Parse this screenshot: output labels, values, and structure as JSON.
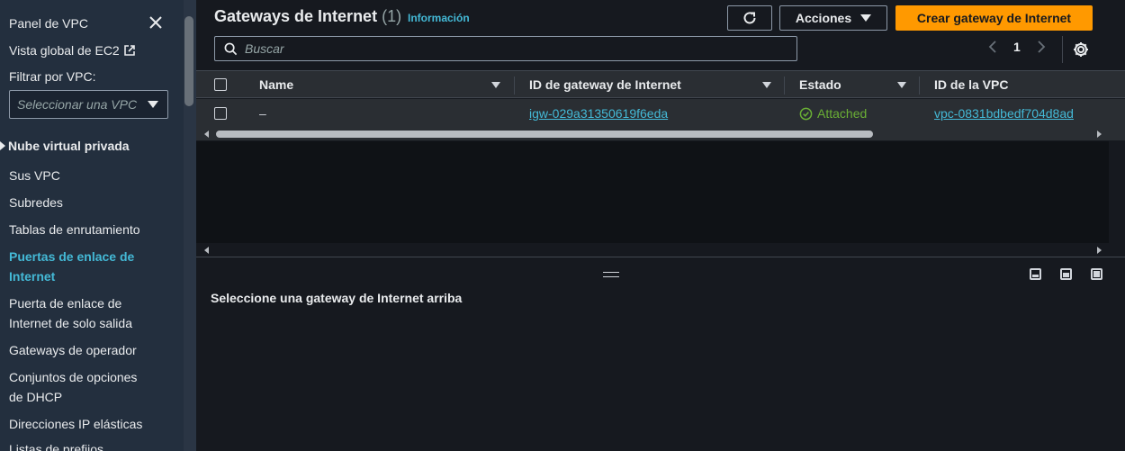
{
  "sidebar": {
    "title": "Panel de VPC",
    "ec2_link": "Vista global de EC2",
    "filter_label": "Filtrar por VPC:",
    "filter_placeholder": "Seleccionar una VPC",
    "section": "Nube virtual privada",
    "items": [
      {
        "label": "Sus VPC"
      },
      {
        "label": "Subredes"
      },
      {
        "label": "Tablas de enrutamiento"
      },
      {
        "label": "Puertas de enlace de Internet",
        "active": true
      },
      {
        "label": "Puerta de enlace de Internet de solo salida"
      },
      {
        "label": "Gateways de operador"
      },
      {
        "label": "Conjuntos de opciones de DHCP"
      },
      {
        "label": "Direcciones IP elásticas"
      },
      {
        "label": "Listas de prefijos"
      }
    ]
  },
  "header": {
    "title": "Gateways de Internet",
    "count": "(1)",
    "info": "Información",
    "actions_label": "Acciones",
    "create_label": "Crear gateway de Internet"
  },
  "search": {
    "placeholder": "Buscar"
  },
  "pagination": {
    "page": "1"
  },
  "table": {
    "columns": [
      "Name",
      "ID de gateway de Internet",
      "Estado",
      "ID de la VPC"
    ],
    "rows": [
      {
        "name": "–",
        "id": "igw-029a31350619f6eda",
        "status": "Attached",
        "vpc": "vpc-0831bdbedf704d8ad"
      }
    ]
  },
  "split_panel": {
    "message": "Seleccione una gateway de Internet arriba"
  },
  "colors": {
    "accent": "#ff9900",
    "link": "#44b9d6",
    "success": "#6aaf35",
    "background": "#16191f",
    "sidebar": "#232f3e"
  }
}
